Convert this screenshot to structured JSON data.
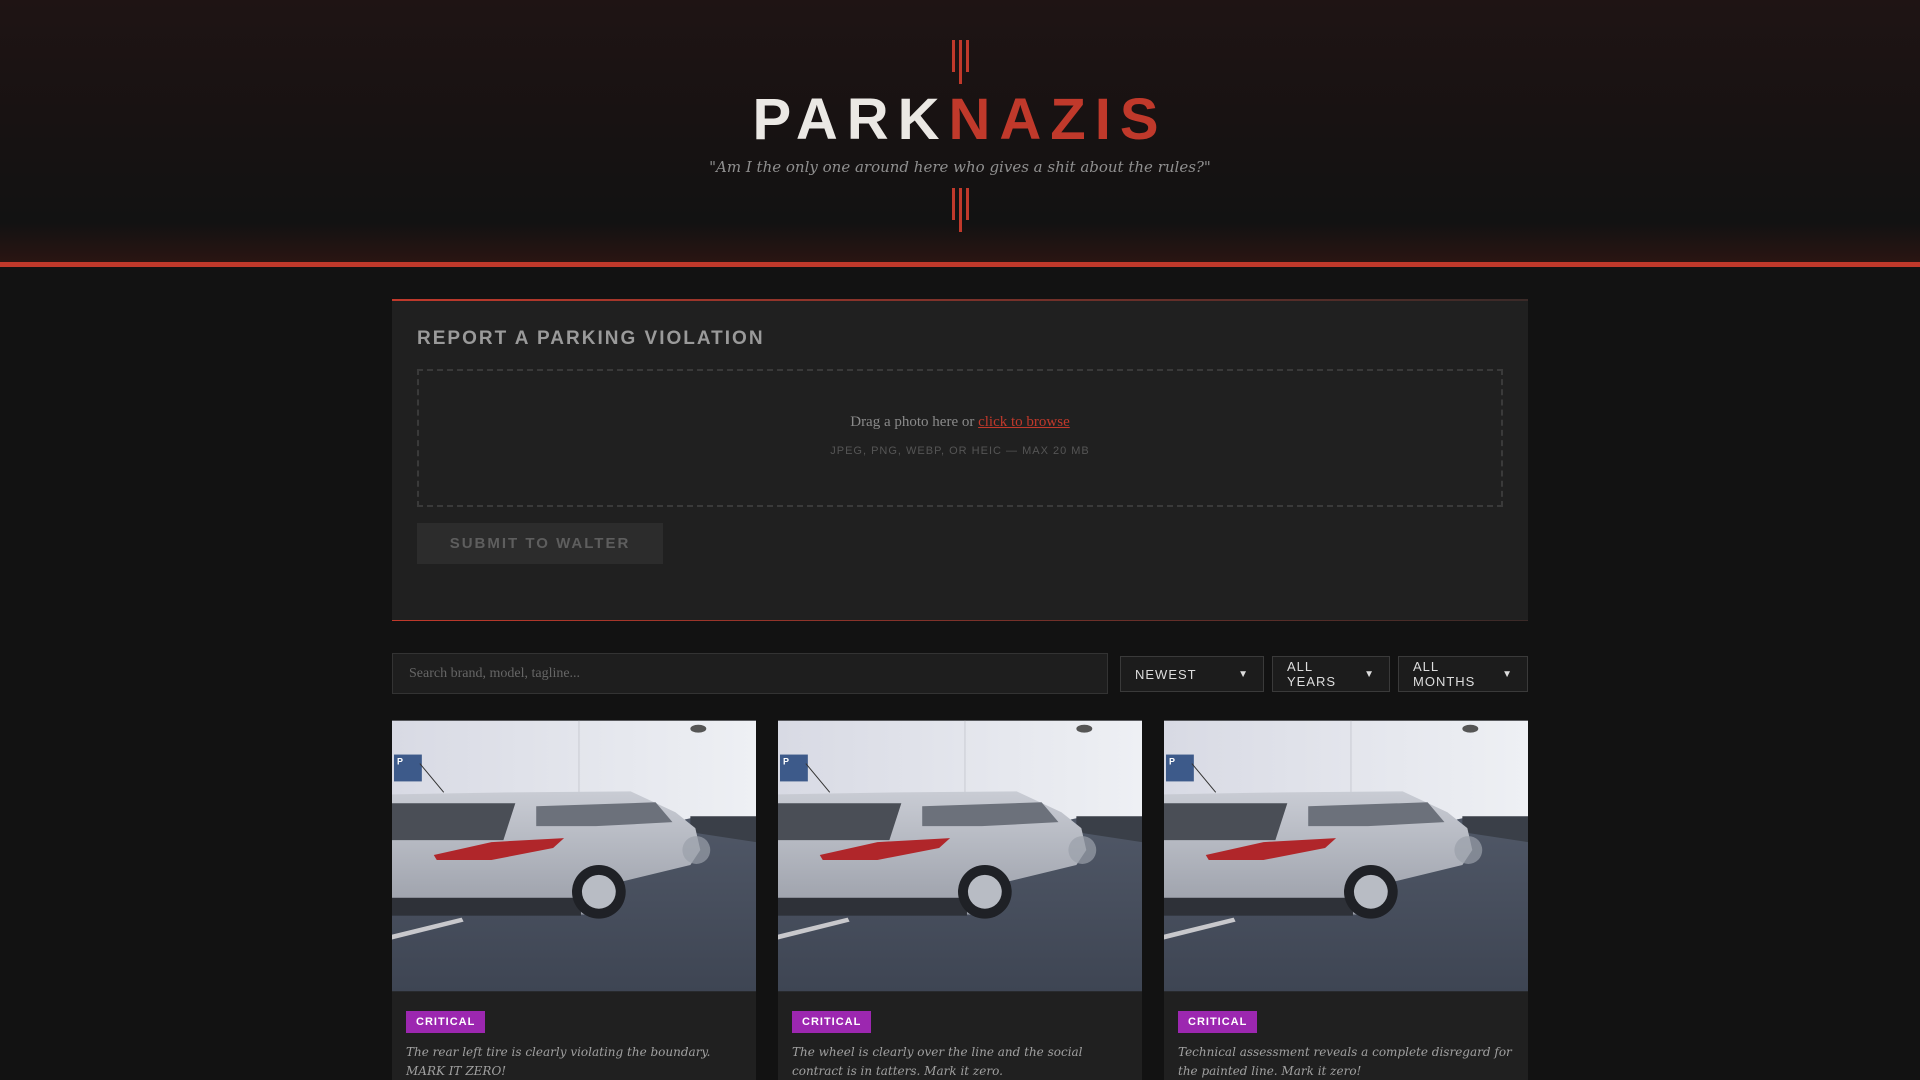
{
  "header": {
    "logo_part1": "PARK",
    "logo_part2": "NAZIS",
    "tagline": "\"Am I the only one around here who gives a shit about the rules?\""
  },
  "report": {
    "title": "REPORT A PARKING VIOLATION",
    "drop_text": "Drag a photo here or ",
    "browse_link": "click to browse",
    "hint": "JPEG, PNG, WEBP, OR HEIC — MAX 20 MB",
    "submit_label": "SUBMIT TO WALTER"
  },
  "filters": {
    "search_placeholder": "Search brand, model, tagline...",
    "sort": "NEWEST",
    "year": "ALL YEARS",
    "month": "ALL MONTHS"
  },
  "colors": {
    "accent": "#c0392b",
    "badge_critical": "#9c27b0"
  },
  "cards": [
    {
      "severity": "CRITICAL",
      "description": "The rear left tire is clearly violating the boundary. MARK IT ZERO!"
    },
    {
      "severity": "CRITICAL",
      "description": "The wheel is clearly over the line and the social contract is in tatters. Mark it zero."
    },
    {
      "severity": "CRITICAL",
      "description": "Technical assessment reveals a complete disregard for the painted line. Mark it zero!"
    }
  ]
}
